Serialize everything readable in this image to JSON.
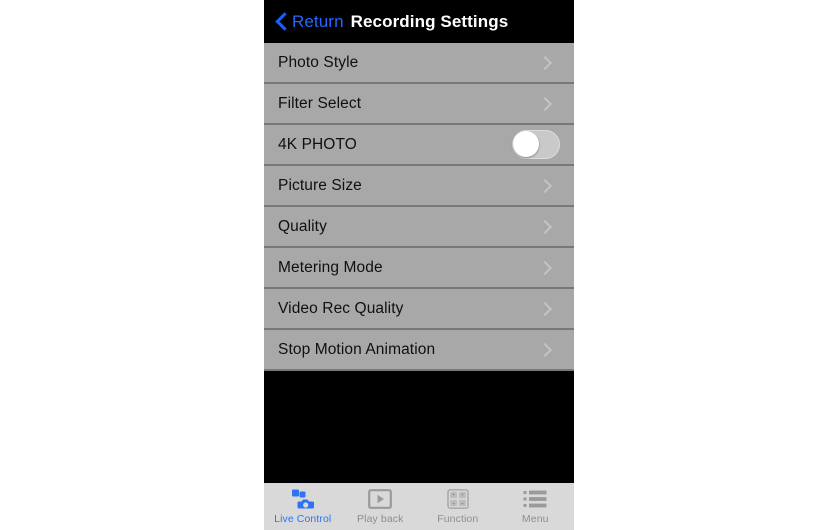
{
  "header": {
    "back_icon": "chevron-left-icon",
    "back_label": "Return",
    "title": "Recording Settings"
  },
  "settings": {
    "rows": [
      {
        "label": "Photo Style",
        "accessory": "chevron"
      },
      {
        "label": "Filter Select",
        "accessory": "chevron"
      },
      {
        "label": "4K PHOTO",
        "accessory": "toggle",
        "toggle_on": false
      },
      {
        "label": "Picture Size",
        "accessory": "chevron"
      },
      {
        "label": "Quality",
        "accessory": "chevron"
      },
      {
        "label": "Metering Mode",
        "accessory": "chevron"
      },
      {
        "label": "Video Rec Quality",
        "accessory": "chevron"
      },
      {
        "label": "Stop Motion Animation",
        "accessory": "chevron"
      }
    ]
  },
  "tab_bar": {
    "tabs": [
      {
        "label": "Live Control",
        "icon": "camera-remote-icon",
        "active": true
      },
      {
        "label": "Play back",
        "icon": "play-square-icon",
        "active": false
      },
      {
        "label": "Function",
        "icon": "grid-four-icon",
        "active": false
      },
      {
        "label": "Menu",
        "icon": "list-bullets-icon",
        "active": false
      }
    ]
  },
  "colors": {
    "accent_blue": "#2468ff",
    "tab_active_blue": "#2f73f2",
    "row_gray": "#a8a8a8",
    "separator_gray": "#787878",
    "tab_bar_gray": "#d9d9d9",
    "screen_black": "#000000"
  }
}
